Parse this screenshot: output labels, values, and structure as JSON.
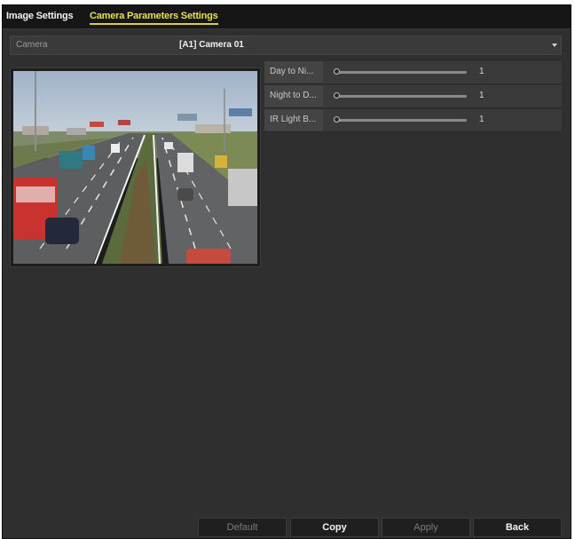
{
  "tabs": [
    {
      "label": "Image Settings"
    },
    {
      "label": "Camera Parameters Settings",
      "active": true
    }
  ],
  "camera": {
    "label": "Camera",
    "value": "[A1] Camera 01"
  },
  "preview": {
    "description": "live camera preview"
  },
  "params": [
    {
      "label": "Day to Ni...",
      "value": "1",
      "level": 0
    },
    {
      "label": "Night to D...",
      "value": "1",
      "level": 0
    },
    {
      "label": "IR Light B...",
      "value": "1",
      "level": 0
    }
  ],
  "buttons": {
    "default": "Default",
    "copy": "Copy",
    "apply": "Apply",
    "back": "Back"
  },
  "colors": {
    "active_tab": "#e7e05a",
    "background": "#2f2f2f"
  }
}
